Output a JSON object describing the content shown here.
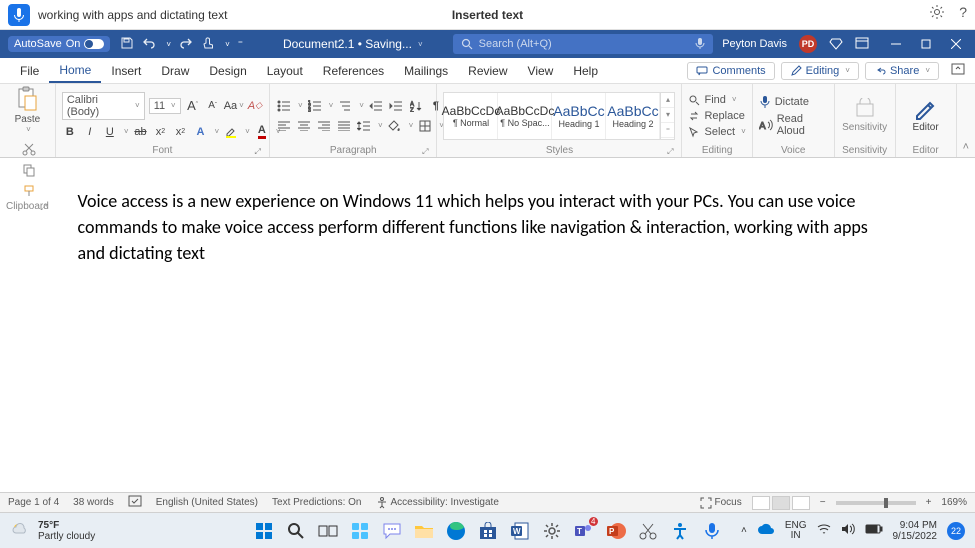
{
  "voice_bar": {
    "spoken_text": "working with apps and dictating text",
    "status": "Inserted text"
  },
  "title_bar": {
    "autosave_label": "AutoSave",
    "autosave_state": "On",
    "doc_name": "Document2.1 • Saving...",
    "search_placeholder": "Search (Alt+Q)",
    "user_name": "Peyton Davis",
    "user_initials": "PD"
  },
  "tabs": {
    "file": "File",
    "home": "Home",
    "insert": "Insert",
    "draw": "Draw",
    "design": "Design",
    "layout": "Layout",
    "references": "References",
    "mailings": "Mailings",
    "review": "Review",
    "view": "View",
    "help": "Help",
    "comments": "Comments",
    "editing": "Editing",
    "share": "Share"
  },
  "ribbon": {
    "clipboard": {
      "paste": "Paste",
      "label": "Clipboard"
    },
    "font": {
      "family": "Calibri (Body)",
      "size": "11",
      "label": "Font"
    },
    "paragraph": {
      "label": "Paragraph"
    },
    "styles": {
      "s1": "¶ Normal",
      "s2": "¶ No Spac...",
      "s3": "Heading 1",
      "s4": "Heading 2",
      "preview": "AaBbCcDc",
      "preview_h": "AaBbCc",
      "label": "Styles"
    },
    "editing": {
      "find": "Find",
      "replace": "Replace",
      "select": "Select",
      "label": "Editing"
    },
    "voice": {
      "dictate": "Dictate",
      "read_aloud": "Read Aloud",
      "label": "Voice"
    },
    "sensitivity": {
      "btn": "Sensitivity",
      "label": "Sensitivity"
    },
    "editor": {
      "btn": "Editor",
      "label": "Editor"
    }
  },
  "document": {
    "body": "Voice access is a new experience on Windows 11 which helps you interact with your PCs. You can use voice commands to make voice access perform different functions like navigation & interaction, working with apps and dictating text"
  },
  "status_bar": {
    "page": "Page 1 of 4",
    "words": "38 words",
    "language": "English (United States)",
    "predictions": "Text Predictions: On",
    "accessibility": "Accessibility: Investigate",
    "focus": "Focus",
    "zoom": "169%"
  },
  "taskbar": {
    "temp": "75°F",
    "weather": "Partly cloudy",
    "lang1": "ENG",
    "lang2": "IN",
    "time": "9:04 PM",
    "date": "9/15/2022",
    "notif_count": "22"
  }
}
